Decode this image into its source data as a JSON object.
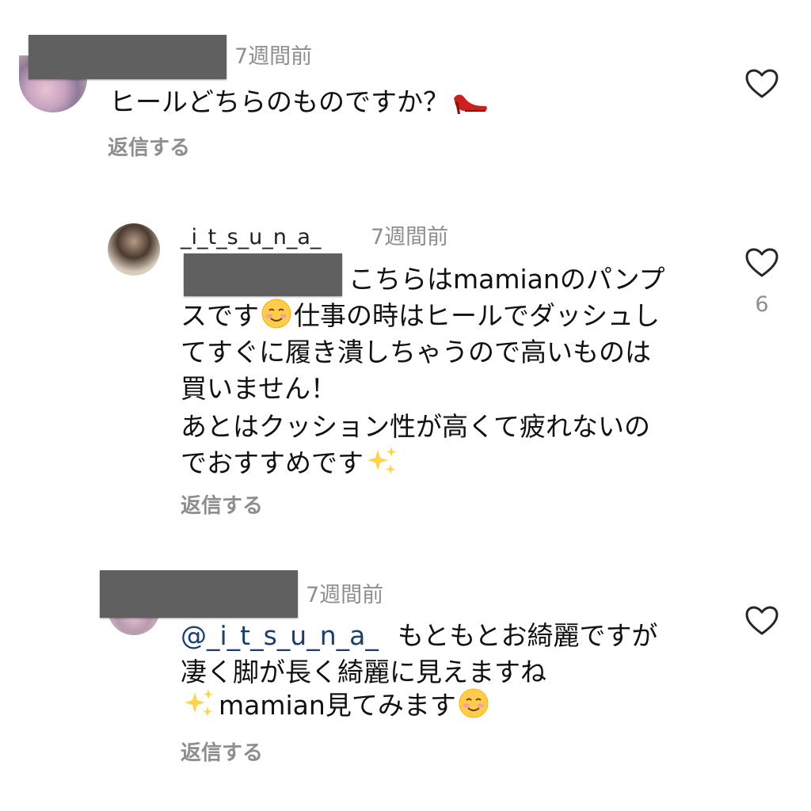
{
  "comments": [
    {
      "time": "7週間前",
      "text": "ヒールどちらのものですか？",
      "reply": "返信する"
    },
    {
      "username": "_i_t_s_u_n_a_",
      "time": "7週間前",
      "line1": "こちらはmamianのパンプ",
      "line2": "スです",
      "line2b": "仕事の時はヒールでダッシュし",
      "line3": "てすぐに履き潰しちゃうので高いものは",
      "line4": "買いません！",
      "line5": "あとはクッション性が高くて疲れないの",
      "line6": "でおすすめです",
      "likes": "6",
      "reply": "返信する"
    },
    {
      "time": "7週間前",
      "mention": "@_i_t_s_u_n_a_",
      "line1": "もともとお綺麗ですが",
      "line2": "凄く脚が長く綺麗に見えますね",
      "line3": "mamian見てみます",
      "reply": "返信する"
    }
  ],
  "icons": [
    "heart-outline-icon",
    "high-heel-emoji",
    "smiling-face-emoji",
    "sparkles-emoji"
  ],
  "colors": {
    "background": "#ffffff",
    "muted": "#8e8e8e",
    "mention": "#1a3f6e",
    "redaction": "#606060"
  }
}
